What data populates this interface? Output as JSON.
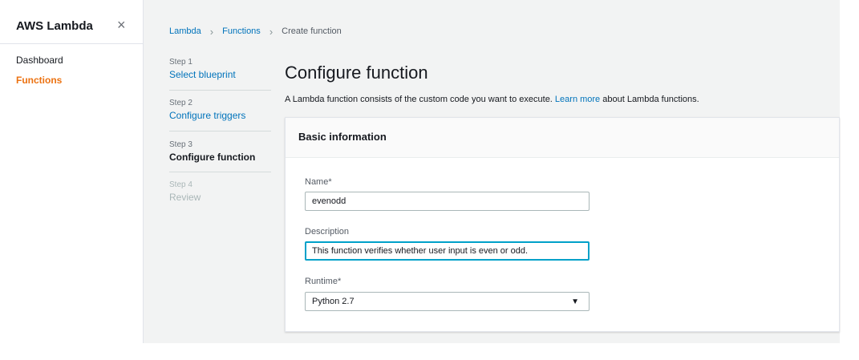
{
  "sidebar": {
    "title": "AWS Lambda",
    "close_icon": "×",
    "items": [
      {
        "label": "Dashboard",
        "active": false
      },
      {
        "label": "Functions",
        "active": true
      }
    ]
  },
  "breadcrumb": {
    "items": [
      "Lambda",
      "Functions"
    ],
    "separator": "›",
    "current": "Create function"
  },
  "steps": [
    {
      "number": "Step 1",
      "label": "Select blueprint",
      "state": "link"
    },
    {
      "number": "Step 2",
      "label": "Configure triggers",
      "state": "link"
    },
    {
      "number": "Step 3",
      "label": "Configure function",
      "state": "current"
    },
    {
      "number": "Step 4",
      "label": "Review",
      "state": "disabled"
    }
  ],
  "page": {
    "title": "Configure function",
    "description_prefix": "A Lambda function consists of the custom code you want to execute. ",
    "description_link": "Learn more",
    "description_suffix": " about Lambda functions."
  },
  "panel": {
    "title": "Basic information",
    "fields": {
      "name": {
        "label": "Name*",
        "value": "evenodd"
      },
      "description": {
        "label": "Description",
        "value": "This function verifies whether user input is even or odd."
      },
      "runtime": {
        "label": "Runtime*",
        "value": "Python 2.7",
        "arrow": "▼"
      }
    }
  },
  "colors": {
    "accent_orange": "#ec7211",
    "link_blue": "#0073bb",
    "focus_blue": "#00a1c9"
  }
}
